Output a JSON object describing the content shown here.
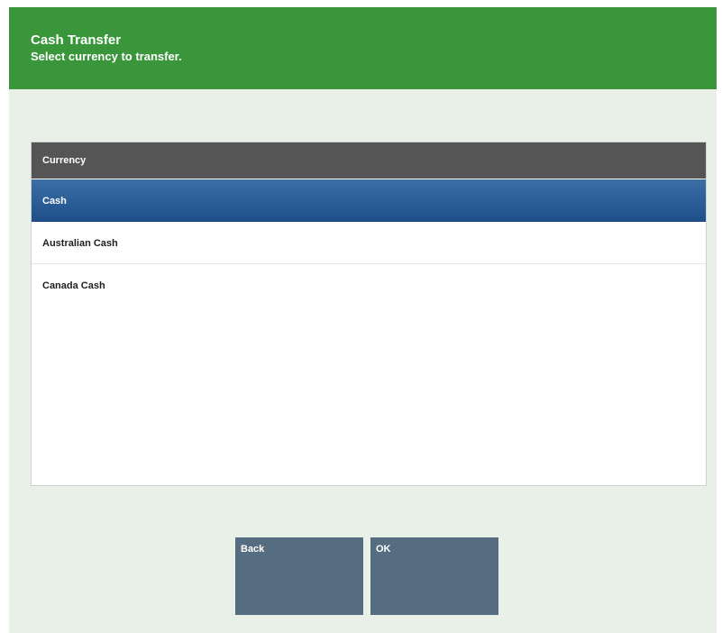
{
  "header": {
    "title": "Cash Transfer",
    "subtitle": "Select currency to transfer."
  },
  "list": {
    "column_header": "Currency",
    "items": [
      {
        "label": "Cash",
        "selected": true
      },
      {
        "label": "Australian Cash",
        "selected": false
      },
      {
        "label": "Canada Cash",
        "selected": false
      }
    ]
  },
  "buttons": {
    "back_label": "Back",
    "ok_label": "OK"
  },
  "colors": {
    "header_bg": "#3a963a",
    "page_bg": "#e8f0e8",
    "list_header_bg": "#555555",
    "selected_row": "#2b5d98",
    "button_bg": "#566c80"
  }
}
